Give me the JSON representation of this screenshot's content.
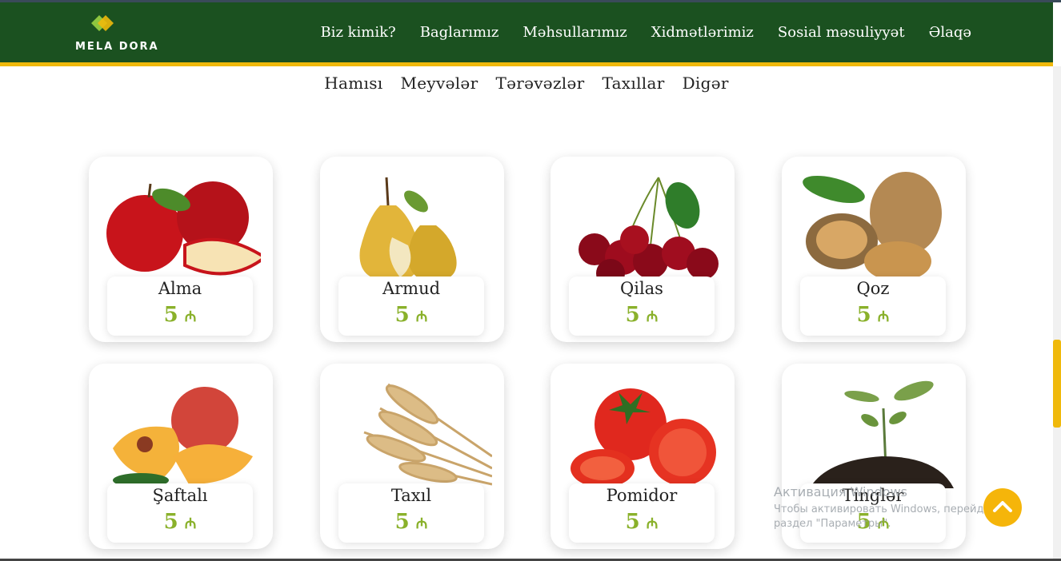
{
  "brand": {
    "name": "MELA DORA",
    "colors": {
      "header": "#1b5120",
      "accent": "#f0b90b",
      "price": "#8ab12b"
    }
  },
  "nav": [
    "Biz kimik?",
    "Baglarımız",
    "Məhsullarımız",
    "Xidmətlərimiz",
    "Sosial məsuliyyət",
    "Əlaqə"
  ],
  "filters": [
    "Hamısı",
    "Meyvələr",
    "Tərəvəzlər",
    "Taxıllar",
    "Digər"
  ],
  "products": [
    {
      "name": "Alma",
      "price": "5",
      "currency": "₼",
      "icon": "apple-image"
    },
    {
      "name": "Armud",
      "price": "5",
      "currency": "₼",
      "icon": "pear-image"
    },
    {
      "name": "Qilas",
      "price": "5",
      "currency": "₼",
      "icon": "cherry-image"
    },
    {
      "name": "Qoz",
      "price": "5",
      "currency": "₼",
      "icon": "walnut-image"
    },
    {
      "name": "Şaftalı",
      "price": "5",
      "currency": "₼",
      "icon": "peach-image"
    },
    {
      "name": "Taxıl",
      "price": "5",
      "currency": "₼",
      "icon": "wheat-image"
    },
    {
      "name": "Pomidor",
      "price": "5",
      "currency": "₼",
      "icon": "tomato-image"
    },
    {
      "name": "Tinglər",
      "price": "5",
      "currency": "₼",
      "icon": "sapling-image"
    }
  ],
  "windows_watermark": {
    "title": "Активация Windows",
    "line1": "Чтобы активировать Windows, перейдите в",
    "line2": "раздел \"Параметры\"."
  }
}
